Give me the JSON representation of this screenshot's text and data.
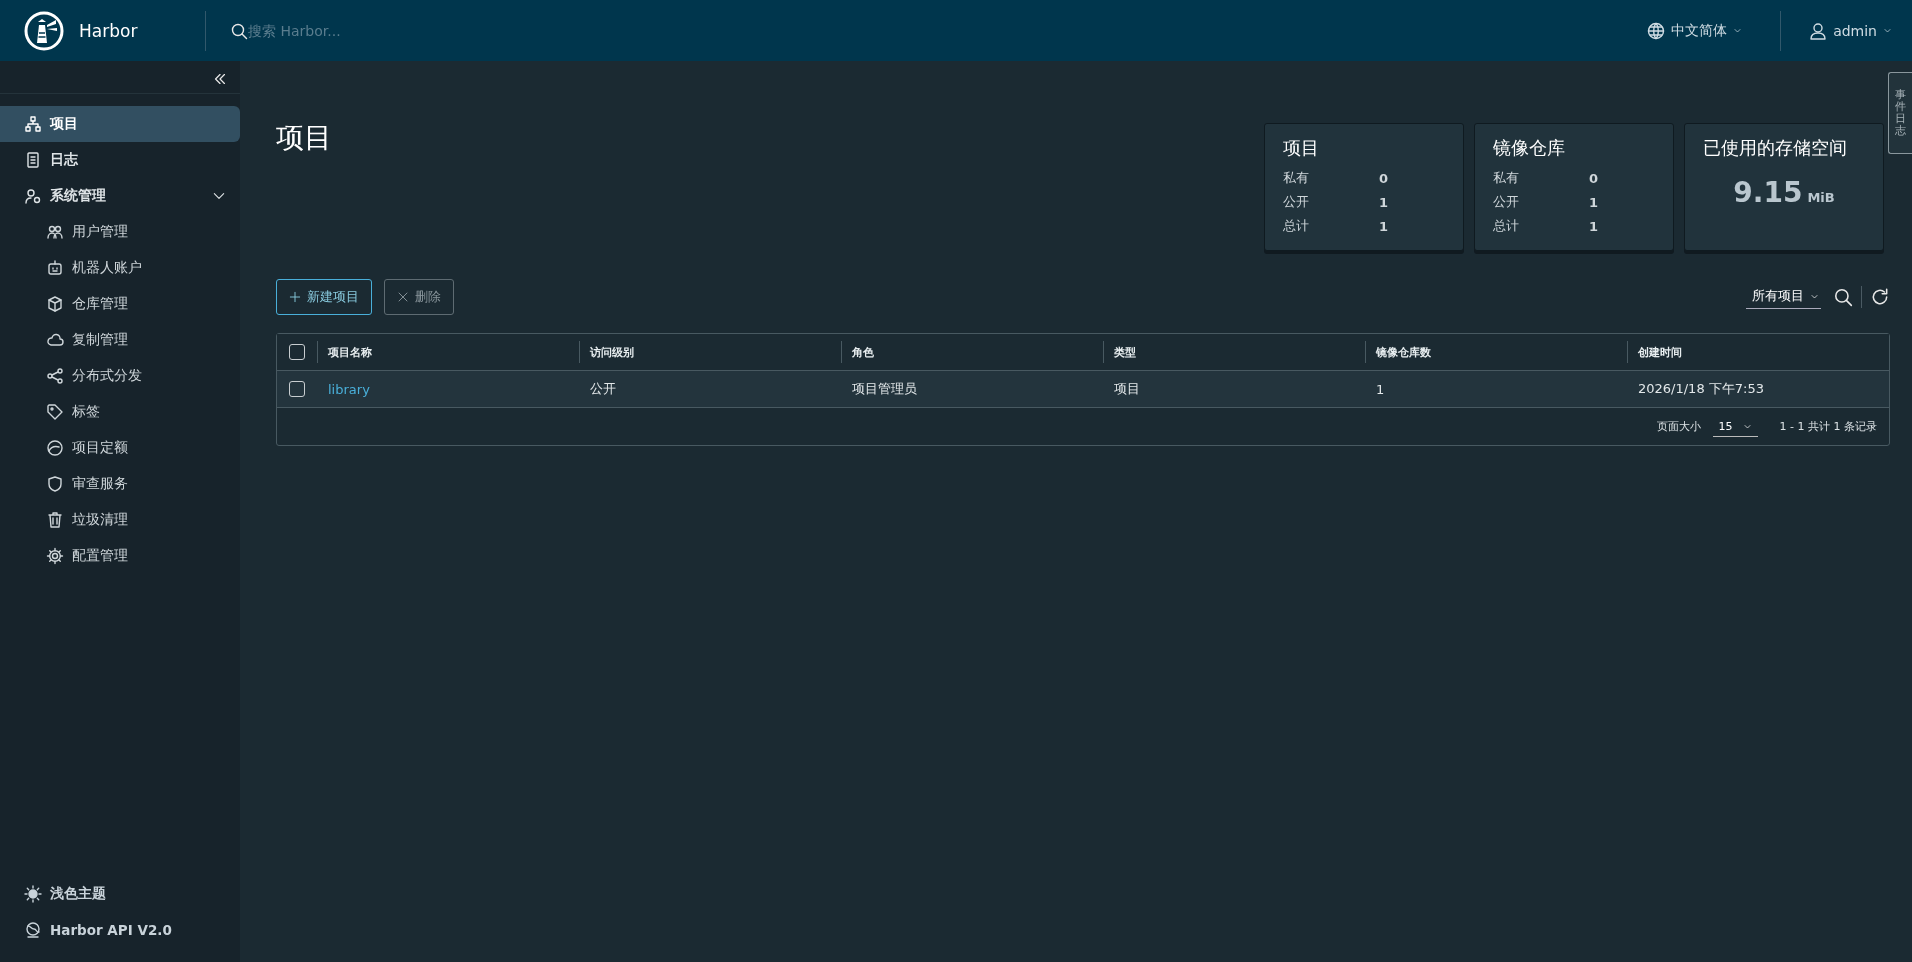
{
  "header": {
    "product": "Harbor",
    "search": {
      "placeholder": "搜索 Harbor..."
    },
    "language": "中文简体",
    "user": "admin"
  },
  "sidebar": {
    "items": [
      {
        "label": "项目",
        "selected": true
      },
      {
        "label": "日志",
        "selected": false
      },
      {
        "label": "系统管理",
        "selected": false,
        "expanded": true,
        "children": [
          {
            "label": "用户管理",
            "selected": false
          },
          {
            "label": "机器人账户",
            "selected": false
          },
          {
            "label": "仓库管理",
            "selected": false
          },
          {
            "label": "复制管理",
            "selected": false
          },
          {
            "label": "分布式分发",
            "selected": false
          },
          {
            "label": "标签",
            "selected": false
          },
          {
            "label": "项目定额",
            "selected": false
          },
          {
            "label": "审查服务",
            "selected": false
          },
          {
            "label": "垃圾清理",
            "selected": false
          },
          {
            "label": "配置管理",
            "selected": false
          }
        ]
      }
    ],
    "footer": [
      "浅色主题",
      "Harbor API V2.0"
    ]
  },
  "page_title": "项目",
  "stats": [
    {
      "kind": "counts",
      "title": "项目",
      "rows": [
        {
          "label": "私有",
          "value": "0"
        },
        {
          "label": "公开",
          "value": "1"
        },
        {
          "label": "总计",
          "value": "1"
        }
      ]
    },
    {
      "kind": "counts",
      "title": "镜像仓库",
      "rows": [
        {
          "label": "私有",
          "value": "0"
        },
        {
          "label": "公开",
          "value": "1"
        },
        {
          "label": "总计",
          "value": "1"
        }
      ]
    },
    {
      "kind": "amount",
      "title": "已使用的存储空间",
      "value": "9.15",
      "unit": "MiB"
    }
  ],
  "toolbar": {
    "buttons": [
      {
        "label": "新建项目",
        "disabled": false
      },
      {
        "label": "删除",
        "disabled": true
      }
    ],
    "filter": "所有项目"
  },
  "table": {
    "select_all": {
      "checked": false
    },
    "columns": [
      "项目名称",
      "访问级别",
      "角色",
      "类型",
      "镜像仓库数",
      "创建时间"
    ],
    "rows": [
      {
        "selected": false,
        "cells": [
          "library",
          "公开",
          "项目管理员",
          "项目",
          "1",
          "2026/1/18 下午7:53"
        ]
      }
    ],
    "footer": {
      "page_size_label": "页面大小",
      "page_size": "15",
      "summary": "1 - 1 共计 1 条记录"
    }
  },
  "side_tab": "事件日志"
}
